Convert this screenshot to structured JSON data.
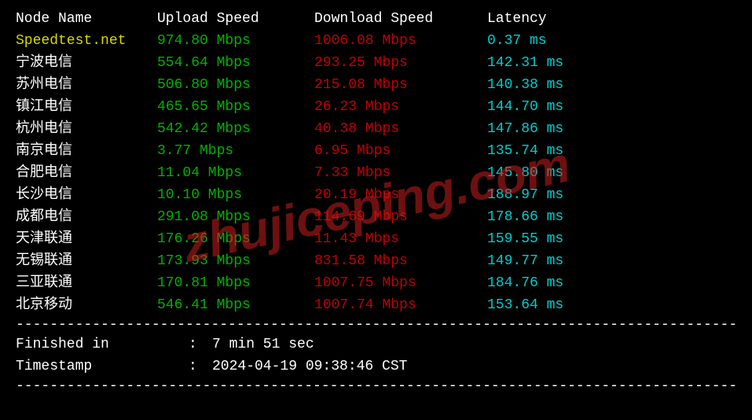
{
  "header": {
    "node": "Node Name",
    "upload": "Upload Speed",
    "download": "Download Speed",
    "latency": "Latency"
  },
  "rows": [
    {
      "node": "Speedtest.net",
      "up": "974.80 Mbps",
      "down": "1006.08 Mbps",
      "lat": "0.37 ms",
      "nodeColor": "yellow"
    },
    {
      "node": "宁波电信",
      "up": "554.64 Mbps",
      "down": "293.25 Mbps",
      "lat": "142.31 ms",
      "nodeColor": "white"
    },
    {
      "node": "苏州电信",
      "up": "506.80 Mbps",
      "down": "215.08 Mbps",
      "lat": "140.38 ms",
      "nodeColor": "white"
    },
    {
      "node": "镇江电信",
      "up": "465.65 Mbps",
      "down": "26.23 Mbps",
      "lat": "144.70 ms",
      "nodeColor": "white"
    },
    {
      "node": "杭州电信",
      "up": "542.42 Mbps",
      "down": "40.38 Mbps",
      "lat": "147.86 ms",
      "nodeColor": "white"
    },
    {
      "node": "南京电信",
      "up": "3.77 Mbps",
      "down": "6.95 Mbps",
      "lat": "135.74 ms",
      "nodeColor": "white"
    },
    {
      "node": "合肥电信",
      "up": "11.04 Mbps",
      "down": "7.33 Mbps",
      "lat": "145.80 ms",
      "nodeColor": "white"
    },
    {
      "node": "长沙电信",
      "up": "10.10 Mbps",
      "down": "20.19 Mbps",
      "lat": "188.97 ms",
      "nodeColor": "white"
    },
    {
      "node": "成都电信",
      "up": "291.08 Mbps",
      "down": "114.69 Mbps",
      "lat": "178.66 ms",
      "nodeColor": "white"
    },
    {
      "node": "天津联通",
      "up": "176.26 Mbps",
      "down": "11.43 Mbps",
      "lat": "159.55 ms",
      "nodeColor": "white"
    },
    {
      "node": "无锡联通",
      "up": "173.93 Mbps",
      "down": "831.58 Mbps",
      "lat": "149.77 ms",
      "nodeColor": "white"
    },
    {
      "node": "三亚联通",
      "up": "170.81 Mbps",
      "down": "1007.75 Mbps",
      "lat": "184.76 ms",
      "nodeColor": "white"
    },
    {
      "node": "北京移动",
      "up": "546.41 Mbps",
      "down": "1007.74 Mbps",
      "lat": "153.64 ms",
      "nodeColor": "white"
    }
  ],
  "footer": {
    "finished_label": "Finished in",
    "finished_value": "7 min 51 sec",
    "timestamp_label": "Timestamp",
    "timestamp_value": "2024-04-19 09:38:46 CST"
  },
  "watermark": "zhujiceping.com",
  "divider": "--------------------------------------------------------------------------------------"
}
